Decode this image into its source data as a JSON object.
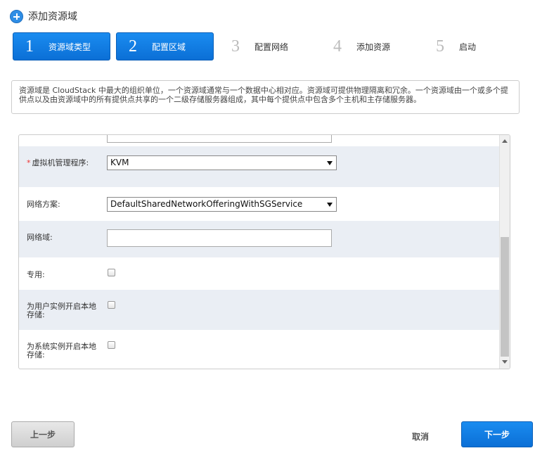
{
  "header": {
    "title": "添加资源域",
    "icon": "plus-circle-icon"
  },
  "steps": [
    {
      "num": "1",
      "label": "资源域类型",
      "active": true
    },
    {
      "num": "2",
      "label": "配置区域",
      "active": true
    },
    {
      "num": "3",
      "label": "配置网络",
      "active": false
    },
    {
      "num": "4",
      "label": "添加资源",
      "active": false
    },
    {
      "num": "5",
      "label": "启动",
      "active": false
    }
  ],
  "description": "资源域是 CloudStack 中最大的组织单位，一个资源域通常与一个数据中心相对应。资源域可提供物理隔离和冗余。一个资源域由一个或多个提供点以及由资源域中的所有提供点共享的一个二级存储服务器组成，其中每个提供点中包含多个主机和主存储服务器。",
  "form": {
    "hypervisor": {
      "required_mark": "*",
      "label": "虚拟机管理程序:",
      "value": "KVM"
    },
    "network_offering": {
      "label": "网络方案:",
      "value": "DefaultSharedNetworkOfferingWithSGService"
    },
    "network_domain": {
      "label": "网络域:",
      "value": ""
    },
    "dedicated": {
      "label": "专用:",
      "checked": false
    },
    "local_storage_user": {
      "label": "为用户实例开启本地存储:",
      "checked": false
    },
    "local_storage_system": {
      "label": "为系统实例开启本地存储:",
      "checked": false
    }
  },
  "buttons": {
    "prev": "上一步",
    "cancel": "取消",
    "next": "下一步"
  },
  "colors": {
    "accent": "#0b6fd6",
    "row_shade": "#eaeef4",
    "required": "#e33333"
  }
}
